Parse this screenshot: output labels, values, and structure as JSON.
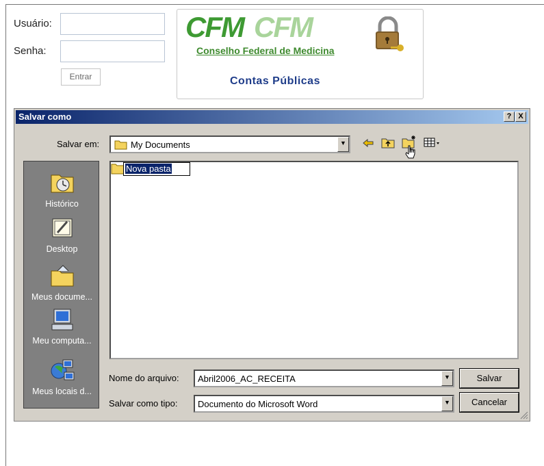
{
  "login": {
    "user_label": "Usuário:",
    "password_label": "Senha:",
    "enter_label": "Entrar"
  },
  "logo": {
    "abbreviation": "CFM",
    "org_name": "Conselho Federal de Medicina",
    "section_title": "Contas Públicas"
  },
  "dialog": {
    "title": "Salvar como",
    "help_label": "?",
    "close_label": "X",
    "save_in_label": "Salvar em:",
    "save_in_value": "My Documents",
    "places": [
      "Histórico",
      "Desktop",
      "Meus docume...",
      "Meu computa...",
      "Meus locais d..."
    ],
    "new_folder_name": "Nova pasta",
    "file_name_label": "Nome do arquivo:",
    "file_name_value": "Abril2006_AC_RECEITA",
    "file_type_label": "Salvar como tipo:",
    "file_type_value": "Documento do Microsoft Word",
    "save_button": "Salvar",
    "cancel_button": "Cancelar",
    "icons": [
      "back-icon",
      "up-folder-icon",
      "new-folder-icon",
      "view-menu-icon"
    ]
  },
  "colors": {
    "titlebar_start": "#0a246a",
    "titlebar_end": "#a6caf0",
    "dialog_face": "#d4d0c8",
    "logo_green": "#3e9a33",
    "contas_blue": "#1f3d8a"
  }
}
